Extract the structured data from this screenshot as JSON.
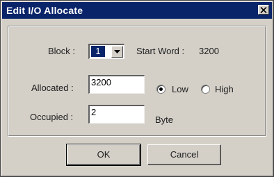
{
  "window": {
    "title": "Edit I/O Allocate"
  },
  "block": {
    "label": "Block :",
    "value": "1"
  },
  "start_word": {
    "label": "Start Word :",
    "value": "3200"
  },
  "allocated": {
    "label": "Allocated :",
    "value": "3200"
  },
  "byte_order": {
    "low_label": "Low",
    "high_label": "High",
    "selected": "Low"
  },
  "occupied": {
    "label": "Occupied :",
    "value": "2",
    "unit": "Byte"
  },
  "buttons": {
    "ok": "OK",
    "cancel": "Cancel"
  },
  "icons": {
    "close": "close-icon",
    "dropdown": "chevron-down-icon"
  },
  "colors": {
    "titlebar": "#0a246a",
    "dialog_face": "#d4d0c8",
    "selection": "#0a246a"
  }
}
